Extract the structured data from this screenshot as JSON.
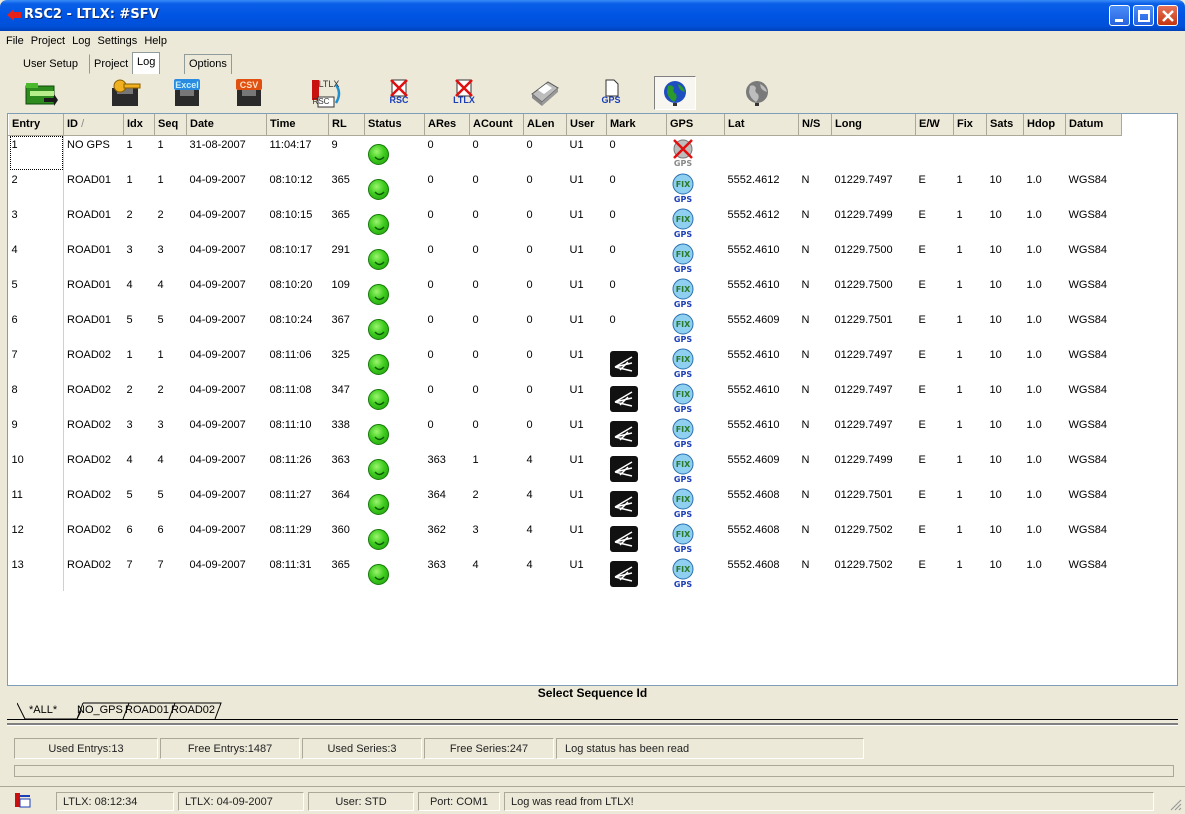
{
  "window": {
    "title": "RSC2  -  LTLX: #SFV"
  },
  "menu": [
    "File",
    "Project",
    "Log",
    "Settings",
    "Help"
  ],
  "tabs": {
    "user_setup": "User Setup",
    "project": "Project",
    "log": "Log",
    "options": "Options"
  },
  "toolbar": {
    "excel_label": "Excel",
    "csv_label": "CSV",
    "ltlx_to_rsc_top": "LTLX",
    "ltlx_to_rsc_bottom": "RSC",
    "delete_rsc": "RSC",
    "delete_ltlx": "LTLX",
    "gps_label": "GPS"
  },
  "table": {
    "columns": [
      "Entry",
      "ID",
      "Idx",
      "Seq",
      "Date",
      "Time",
      "RL",
      "Status",
      "ARes",
      "ACount",
      "ALen",
      "User",
      "Mark",
      "GPS",
      "Lat",
      "N/S",
      "Long",
      "E/W",
      "Fix",
      "Sats",
      "Hdop",
      "Datum"
    ],
    "sort_indicator": "/",
    "rows": [
      {
        "entry": "1",
        "id": "NO GPS",
        "idx": "1",
        "seq": "1",
        "date": "31-08-2007",
        "time": "11:04:17",
        "rl": "9",
        "ares": "0",
        "acount": "0",
        "alen": "0",
        "user": "U1",
        "mark": "0",
        "gps": "nogps",
        "lat": "",
        "ns": "",
        "long": "",
        "ew": "",
        "fix": "",
        "sats": "",
        "hdop": "",
        "datum": ""
      },
      {
        "entry": "2",
        "id": "ROAD01",
        "idx": "1",
        "seq": "1",
        "date": "04-09-2007",
        "time": "08:10:12",
        "rl": "365",
        "ares": "0",
        "acount": "0",
        "alen": "0",
        "user": "U1",
        "mark": "0",
        "gps": "fix",
        "lat": "5552.4612",
        "ns": "N",
        "long": "01229.7497",
        "ew": "E",
        "fix": "1",
        "sats": "10",
        "hdop": "1.0",
        "datum": "WGS84"
      },
      {
        "entry": "3",
        "id": "ROAD01",
        "idx": "2",
        "seq": "2",
        "date": "04-09-2007",
        "time": "08:10:15",
        "rl": "365",
        "ares": "0",
        "acount": "0",
        "alen": "0",
        "user": "U1",
        "mark": "0",
        "gps": "fix",
        "lat": "5552.4612",
        "ns": "N",
        "long": "01229.7499",
        "ew": "E",
        "fix": "1",
        "sats": "10",
        "hdop": "1.0",
        "datum": "WGS84"
      },
      {
        "entry": "4",
        "id": "ROAD01",
        "idx": "3",
        "seq": "3",
        "date": "04-09-2007",
        "time": "08:10:17",
        "rl": "291",
        "ares": "0",
        "acount": "0",
        "alen": "0",
        "user": "U1",
        "mark": "0",
        "gps": "fix",
        "lat": "5552.4610",
        "ns": "N",
        "long": "01229.7500",
        "ew": "E",
        "fix": "1",
        "sats": "10",
        "hdop": "1.0",
        "datum": "WGS84"
      },
      {
        "entry": "5",
        "id": "ROAD01",
        "idx": "4",
        "seq": "4",
        "date": "04-09-2007",
        "time": "08:10:20",
        "rl": "109",
        "ares": "0",
        "acount": "0",
        "alen": "0",
        "user": "U1",
        "mark": "0",
        "gps": "fix",
        "lat": "5552.4610",
        "ns": "N",
        "long": "01229.7500",
        "ew": "E",
        "fix": "1",
        "sats": "10",
        "hdop": "1.0",
        "datum": "WGS84"
      },
      {
        "entry": "6",
        "id": "ROAD01",
        "idx": "5",
        "seq": "5",
        "date": "04-09-2007",
        "time": "08:10:24",
        "rl": "367",
        "ares": "0",
        "acount": "0",
        "alen": "0",
        "user": "U1",
        "mark": "0",
        "gps": "fix",
        "lat": "5552.4609",
        "ns": "N",
        "long": "01229.7501",
        "ew": "E",
        "fix": "1",
        "sats": "10",
        "hdop": "1.0",
        "datum": "WGS84"
      },
      {
        "entry": "7",
        "id": "ROAD02",
        "idx": "1",
        "seq": "1",
        "date": "04-09-2007",
        "time": "08:11:06",
        "rl": "325",
        "ares": "0",
        "acount": "0",
        "alen": "0",
        "user": "U1",
        "mark": "icon",
        "gps": "fix",
        "lat": "5552.4610",
        "ns": "N",
        "long": "01229.7497",
        "ew": "E",
        "fix": "1",
        "sats": "10",
        "hdop": "1.0",
        "datum": "WGS84"
      },
      {
        "entry": "8",
        "id": "ROAD02",
        "idx": "2",
        "seq": "2",
        "date": "04-09-2007",
        "time": "08:11:08",
        "rl": "347",
        "ares": "0",
        "acount": "0",
        "alen": "0",
        "user": "U1",
        "mark": "icon",
        "gps": "fix",
        "lat": "5552.4610",
        "ns": "N",
        "long": "01229.7497",
        "ew": "E",
        "fix": "1",
        "sats": "10",
        "hdop": "1.0",
        "datum": "WGS84"
      },
      {
        "entry": "9",
        "id": "ROAD02",
        "idx": "3",
        "seq": "3",
        "date": "04-09-2007",
        "time": "08:11:10",
        "rl": "338",
        "ares": "0",
        "acount": "0",
        "alen": "0",
        "user": "U1",
        "mark": "icon",
        "gps": "fix",
        "lat": "5552.4610",
        "ns": "N",
        "long": "01229.7497",
        "ew": "E",
        "fix": "1",
        "sats": "10",
        "hdop": "1.0",
        "datum": "WGS84"
      },
      {
        "entry": "10",
        "id": "ROAD02",
        "idx": "4",
        "seq": "4",
        "date": "04-09-2007",
        "time": "08:11:26",
        "rl": "363",
        "ares": "363",
        "acount": "1",
        "alen": "4",
        "user": "U1",
        "mark": "icon",
        "gps": "fix",
        "lat": "5552.4609",
        "ns": "N",
        "long": "01229.7499",
        "ew": "E",
        "fix": "1",
        "sats": "10",
        "hdop": "1.0",
        "datum": "WGS84"
      },
      {
        "entry": "11",
        "id": "ROAD02",
        "idx": "5",
        "seq": "5",
        "date": "04-09-2007",
        "time": "08:11:27",
        "rl": "364",
        "ares": "364",
        "acount": "2",
        "alen": "4",
        "user": "U1",
        "mark": "icon",
        "gps": "fix",
        "lat": "5552.4608",
        "ns": "N",
        "long": "01229.7501",
        "ew": "E",
        "fix": "1",
        "sats": "10",
        "hdop": "1.0",
        "datum": "WGS84"
      },
      {
        "entry": "12",
        "id": "ROAD02",
        "idx": "6",
        "seq": "6",
        "date": "04-09-2007",
        "time": "08:11:29",
        "rl": "360",
        "ares": "362",
        "acount": "3",
        "alen": "4",
        "user": "U1",
        "mark": "icon",
        "gps": "fix",
        "lat": "5552.4608",
        "ns": "N",
        "long": "01229.7502",
        "ew": "E",
        "fix": "1",
        "sats": "10",
        "hdop": "1.0",
        "datum": "WGS84"
      },
      {
        "entry": "13",
        "id": "ROAD02",
        "idx": "7",
        "seq": "7",
        "date": "04-09-2007",
        "time": "08:11:31",
        "rl": "365",
        "ares": "363",
        "acount": "4",
        "alen": "4",
        "user": "U1",
        "mark": "icon",
        "gps": "fix",
        "lat": "5552.4608",
        "ns": "N",
        "long": "01229.7502",
        "ew": "E",
        "fix": "1",
        "sats": "10",
        "hdop": "1.0",
        "datum": "WGS84"
      }
    ]
  },
  "sequence": {
    "title": "Select Sequence Id",
    "tabs": [
      "*ALL*",
      "NO_GPS",
      "ROAD01",
      "ROAD02"
    ]
  },
  "stats": {
    "used_entrys": "Used Entrys:13",
    "free_entrys": "Free Entrys:1487",
    "used_series": "Used Series:3",
    "free_series": "Free Series:247",
    "log_status": "Log status has been read"
  },
  "statusbar": {
    "ltlx_time": "LTLX: 08:12:34",
    "ltlx_date": "LTLX: 04-09-2007",
    "user": "User: STD",
    "port": "Port: COM1",
    "message": "Log was read from LTLX!"
  },
  "colors": {
    "title_blue": "#0054E3",
    "status_green": "#3FCC1F",
    "face": "#ECE9D8"
  }
}
